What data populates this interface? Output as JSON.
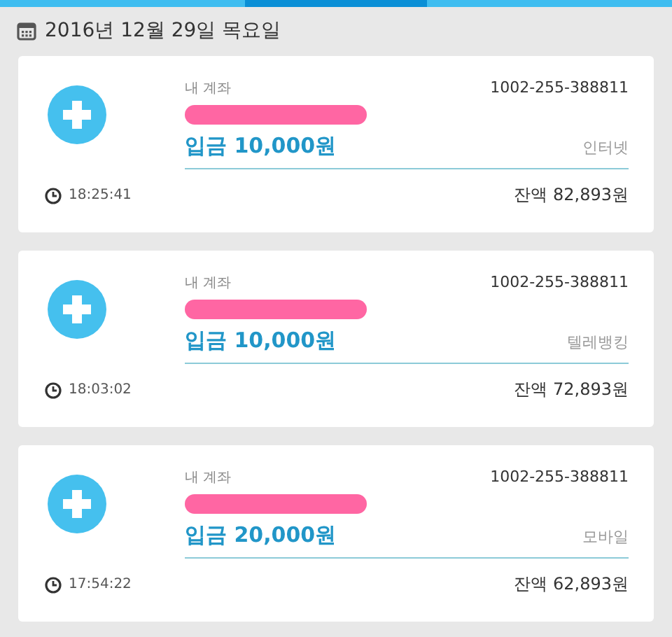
{
  "tabs": [
    {
      "selected": false
    },
    {
      "selected": true
    },
    {
      "selected": false
    }
  ],
  "date_header": "2016년 12월 29일 목요일",
  "transactions": [
    {
      "account_label": "내 계좌",
      "account_number": "1002-255-388811",
      "amount": "입금 10,000원",
      "channel": "인터넷",
      "time": "18:25:41",
      "balance": "잔액 82,893원"
    },
    {
      "account_label": "내 계좌",
      "account_number": "1002-255-388811",
      "amount": "입금 10,000원",
      "channel": "텔레뱅킹",
      "time": "18:03:02",
      "balance": "잔액 72,893원"
    },
    {
      "account_label": "내 계좌",
      "account_number": "1002-255-388811",
      "amount": "입금 20,000원",
      "channel": "모바일",
      "time": "17:54:22",
      "balance": "잔액 62,893원"
    }
  ]
}
